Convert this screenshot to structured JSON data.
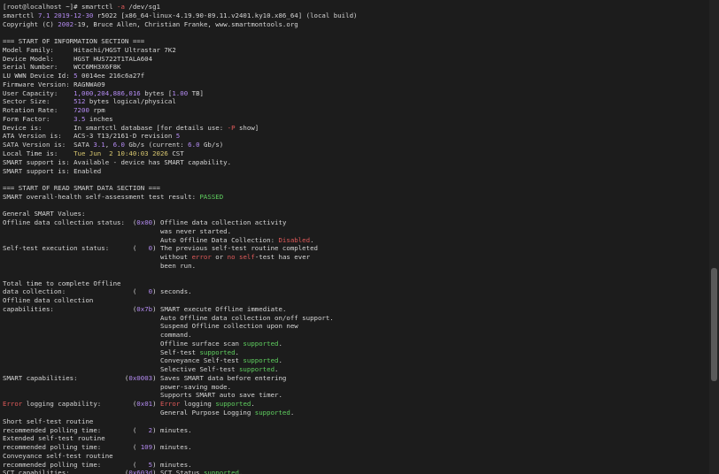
{
  "colors": {
    "background": "#1c1c1c",
    "text": "#d6d6d6",
    "purple": "#b48bf2",
    "yellow": "#d8c770",
    "green": "#5fcf5f",
    "red": "#e05a5a"
  },
  "terminal": {
    "lines": [
      [
        {
          "t": "[root@localhost ~]# smartctl "
        },
        {
          "t": "-a",
          "c": "red"
        },
        {
          "t": " /dev/sg1"
        }
      ],
      [
        {
          "t": "smartctl "
        },
        {
          "t": "7.1 2019-12-30",
          "c": "purple"
        },
        {
          "t": " r5022 [x86_64-linux-4.19.90-89.11.v2401.ky10.x86_64] (local build)"
        }
      ],
      [
        {
          "t": "Copyright (C) "
        },
        {
          "t": "2002",
          "c": "purple"
        },
        {
          "t": "-19, Bruce Allen, Christian Franke, www.smartmontools.org"
        }
      ],
      [],
      [
        {
          "t": "=== START OF INFORMATION SECTION ==="
        }
      ],
      [
        {
          "t": "Model Family:     Hitachi/HGST Ultrastar 7K2"
        }
      ],
      [
        {
          "t": "Device Model:     HGST HUS722T1TALA604"
        }
      ],
      [
        {
          "t": "Serial Number:    WCC6MH3X6F8K"
        }
      ],
      [
        {
          "t": "LU WWN Device Id: "
        },
        {
          "t": "5",
          "c": "purple"
        },
        {
          "t": " 0014ee 216c6a27f"
        }
      ],
      [
        {
          "t": "Firmware Version: RAGNWA09"
        }
      ],
      [
        {
          "t": "User Capacity:    "
        },
        {
          "t": "1,000,204,886,016",
          "c": "purple"
        },
        {
          "t": " bytes ["
        },
        {
          "t": "1.00",
          "c": "purple"
        },
        {
          "t": " TB]"
        }
      ],
      [
        {
          "t": "Sector Size:      "
        },
        {
          "t": "512",
          "c": "purple"
        },
        {
          "t": " bytes logical/physical"
        }
      ],
      [
        {
          "t": "Rotation Rate:    "
        },
        {
          "t": "7200",
          "c": "purple"
        },
        {
          "t": " rpm"
        }
      ],
      [
        {
          "t": "Form Factor:      "
        },
        {
          "t": "3.5",
          "c": "purple"
        },
        {
          "t": " inches"
        }
      ],
      [
        {
          "t": "Device is:        In smartctl database [for details use: "
        },
        {
          "t": "-P",
          "c": "red"
        },
        {
          "t": " show]"
        }
      ],
      [
        {
          "t": "ATA Version is:   ACS-3 T13/2161-D revision "
        },
        {
          "t": "5",
          "c": "purple"
        }
      ],
      [
        {
          "t": "SATA Version is:  SATA "
        },
        {
          "t": "3.1",
          "c": "purple"
        },
        {
          "t": ", "
        },
        {
          "t": "6.0",
          "c": "purple"
        },
        {
          "t": " Gb/s (current: "
        },
        {
          "t": "6.0",
          "c": "purple"
        },
        {
          "t": " Gb/s)"
        }
      ],
      [
        {
          "t": "Local Time is:    "
        },
        {
          "t": "Tue Jun  2 10:40:03 2026",
          "c": "yellow"
        },
        {
          "t": " CST"
        }
      ],
      [
        {
          "t": "SMART support is: Available - device has SMART capability."
        }
      ],
      [
        {
          "t": "SMART support is: Enabled"
        }
      ],
      [],
      [
        {
          "t": "=== START OF READ SMART DATA SECTION ==="
        }
      ],
      [
        {
          "t": "SMART overall-health self-assessment test result: "
        },
        {
          "t": "PASSED",
          "c": "green"
        }
      ],
      [],
      [
        {
          "t": "General SMART Values:"
        }
      ],
      [
        {
          "t": "Offline data collection status:  ("
        },
        {
          "t": "0x00",
          "c": "purple"
        },
        {
          "t": ") Offline data collection activity"
        }
      ],
      [
        {
          "t": "                                        was never started."
        }
      ],
      [
        {
          "t": "                                        Auto Offline Data Collection: "
        },
        {
          "t": "Disabled",
          "c": "red"
        },
        {
          "t": "."
        }
      ],
      [
        {
          "t": "Self-test execution status:      (   "
        },
        {
          "t": "0",
          "c": "purple"
        },
        {
          "t": ") The previous self-test routine completed"
        }
      ],
      [
        {
          "t": "                                        without "
        },
        {
          "t": "error",
          "c": "red"
        },
        {
          "t": " or "
        },
        {
          "t": "no",
          "c": "red"
        },
        {
          "t": " "
        },
        {
          "t": "self",
          "c": "red"
        },
        {
          "t": "-test has ever"
        }
      ],
      [
        {
          "t": "                                        been run."
        }
      ],
      [],
      [
        {
          "t": "Total time to complete Offline"
        }
      ],
      [
        {
          "t": "data collection:                 (   "
        },
        {
          "t": "0",
          "c": "purple"
        },
        {
          "t": ") seconds."
        }
      ],
      [
        {
          "t": "Offline data collection"
        }
      ],
      [
        {
          "t": "capabilities:                    ("
        },
        {
          "t": "0x7b",
          "c": "purple"
        },
        {
          "t": ") SMART execute Offline immediate."
        }
      ],
      [
        {
          "t": "                                        Auto Offline data collection on/off support."
        }
      ],
      [
        {
          "t": "                                        Suspend Offline collection upon new"
        }
      ],
      [
        {
          "t": "                                        command."
        }
      ],
      [
        {
          "t": "                                        Offline surface scan "
        },
        {
          "t": "supported",
          "c": "green"
        },
        {
          "t": "."
        }
      ],
      [
        {
          "t": "                                        Self-test "
        },
        {
          "t": "supported",
          "c": "green"
        },
        {
          "t": "."
        }
      ],
      [
        {
          "t": "                                        Conveyance Self-test "
        },
        {
          "t": "supported",
          "c": "green"
        },
        {
          "t": "."
        }
      ],
      [
        {
          "t": "                                        Selective Self-test "
        },
        {
          "t": "supported",
          "c": "green"
        },
        {
          "t": "."
        }
      ],
      [
        {
          "t": "SMART capabilities:            ("
        },
        {
          "t": "0x0003",
          "c": "purple"
        },
        {
          "t": ") Saves SMART data before entering"
        }
      ],
      [
        {
          "t": "                                        power-saving mode."
        }
      ],
      [
        {
          "t": "                                        Supports SMART auto save timer."
        }
      ],
      [
        {
          "t": "Error",
          "c": "red"
        },
        {
          "t": " logging capability:        ("
        },
        {
          "t": "0x01",
          "c": "purple"
        },
        {
          "t": ") "
        },
        {
          "t": "Error",
          "c": "red"
        },
        {
          "t": " logging "
        },
        {
          "t": "supported",
          "c": "green"
        },
        {
          "t": "."
        }
      ],
      [
        {
          "t": "                                        General Purpose Logging "
        },
        {
          "t": "supported",
          "c": "green"
        },
        {
          "t": "."
        }
      ],
      [
        {
          "t": "Short self-test routine"
        }
      ],
      [
        {
          "t": "recommended polling time:        (   "
        },
        {
          "t": "2",
          "c": "purple"
        },
        {
          "t": ") minutes."
        }
      ],
      [
        {
          "t": "Extended self-test routine"
        }
      ],
      [
        {
          "t": "recommended polling time:        ( "
        },
        {
          "t": "109",
          "c": "purple"
        },
        {
          "t": ") minutes."
        }
      ],
      [
        {
          "t": "Conveyance self-test routine"
        }
      ],
      [
        {
          "t": "recommended polling time:        (   "
        },
        {
          "t": "5",
          "c": "purple"
        },
        {
          "t": ") minutes."
        }
      ],
      [
        {
          "t": "SCT capabilities:              ("
        },
        {
          "t": "0x603d",
          "c": "purple"
        },
        {
          "t": ") SCT Status "
        },
        {
          "t": "supported",
          "c": "green"
        },
        {
          "t": "."
        }
      ]
    ]
  }
}
